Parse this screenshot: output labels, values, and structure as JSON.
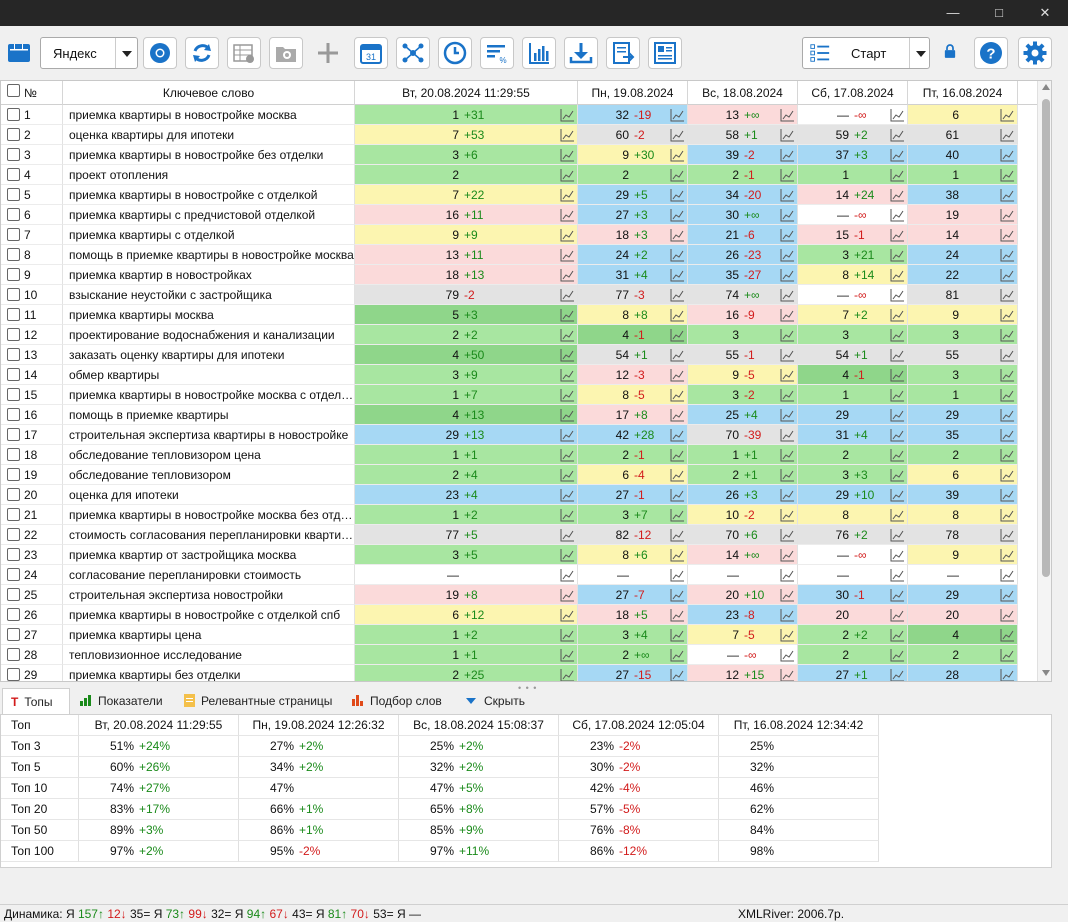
{
  "window_controls": [
    "—",
    "□",
    "✕"
  ],
  "toolbar": {
    "search_engine": "Яндекс",
    "start_label": "Старт",
    "calendar_day": "31"
  },
  "grid": {
    "columns": {
      "num": "№",
      "keyword": "Ключевое слово",
      "dates": [
        "Вт, 20.08.2024 11:29:55",
        "Пн, 19.08.2024",
        "Вс, 18.08.2024",
        "Сб, 17.08.2024",
        "Пт, 16.08.2024"
      ]
    },
    "rows": [
      {
        "n": "1",
        "kw": "приемка квартиры в новостройке москва",
        "c": [
          [
            "1",
            "+31",
            "green"
          ],
          [
            "32",
            "-19",
            "blue"
          ],
          [
            "13",
            "+∞",
            "pink"
          ],
          [
            "—",
            "-∞",
            "white"
          ],
          [
            "6",
            "",
            "yellow"
          ]
        ]
      },
      {
        "n": "2",
        "kw": "оценка квартиры для ипотеки",
        "c": [
          [
            "7",
            "+53",
            "yellow"
          ],
          [
            "60",
            "-2",
            "gray"
          ],
          [
            "58",
            "+1",
            "gray"
          ],
          [
            "59",
            "+2",
            "gray"
          ],
          [
            "61",
            "",
            "gray"
          ]
        ]
      },
      {
        "n": "3",
        "kw": "приемка квартиры в новостройке без отделки",
        "c": [
          [
            "3",
            "+6",
            "green"
          ],
          [
            "9",
            "+30",
            "yellow"
          ],
          [
            "39",
            "-2",
            "blue"
          ],
          [
            "37",
            "+3",
            "blue"
          ],
          [
            "40",
            "",
            "blue"
          ]
        ]
      },
      {
        "n": "4",
        "kw": "проект отопления",
        "c": [
          [
            "2",
            "",
            "green"
          ],
          [
            "2",
            "",
            "green"
          ],
          [
            "2",
            "-1",
            "green"
          ],
          [
            "1",
            "",
            "green"
          ],
          [
            "1",
            "",
            "green"
          ]
        ]
      },
      {
        "n": "5",
        "kw": "приемка квартиры в новостройке с отделкой",
        "c": [
          [
            "7",
            "+22",
            "yellow"
          ],
          [
            "29",
            "+5",
            "blue"
          ],
          [
            "34",
            "-20",
            "blue"
          ],
          [
            "14",
            "+24",
            "pink"
          ],
          [
            "38",
            "",
            "blue"
          ]
        ]
      },
      {
        "n": "6",
        "kw": "приемка квартиры с предчистовой отделкой",
        "c": [
          [
            "16",
            "+11",
            "pink"
          ],
          [
            "27",
            "+3",
            "blue"
          ],
          [
            "30",
            "+∞",
            "blue"
          ],
          [
            "—",
            "-∞",
            "white"
          ],
          [
            "19",
            "",
            "pink"
          ]
        ]
      },
      {
        "n": "7",
        "kw": "приемка квартиры с отделкой",
        "c": [
          [
            "9",
            "+9",
            "yellow"
          ],
          [
            "18",
            "+3",
            "pink"
          ],
          [
            "21",
            "-6",
            "blue"
          ],
          [
            "15",
            "-1",
            "pink"
          ],
          [
            "14",
            "",
            "pink"
          ]
        ]
      },
      {
        "n": "8",
        "kw": "помощь в приемке квартиры в новостройке москва",
        "c": [
          [
            "13",
            "+11",
            "pink"
          ],
          [
            "24",
            "+2",
            "blue"
          ],
          [
            "26",
            "-23",
            "blue"
          ],
          [
            "3",
            "+21",
            "green"
          ],
          [
            "24",
            "",
            "blue"
          ]
        ]
      },
      {
        "n": "9",
        "kw": "приемка квартир в новостройках",
        "c": [
          [
            "18",
            "+13",
            "pink"
          ],
          [
            "31",
            "+4",
            "blue"
          ],
          [
            "35",
            "-27",
            "blue"
          ],
          [
            "8",
            "+14",
            "yellow"
          ],
          [
            "22",
            "",
            "blue"
          ]
        ]
      },
      {
        "n": "10",
        "kw": "взыскание неустойки с застройщика",
        "c": [
          [
            "79",
            "-2",
            "gray"
          ],
          [
            "77",
            "-3",
            "gray"
          ],
          [
            "74",
            "+∞",
            "gray"
          ],
          [
            "—",
            "-∞",
            "white"
          ],
          [
            "81",
            "",
            "gray"
          ]
        ]
      },
      {
        "n": "11",
        "kw": "приемка квартиры москва",
        "c": [
          [
            "5",
            "+3",
            "dgreen"
          ],
          [
            "8",
            "+8",
            "yellow"
          ],
          [
            "16",
            "-9",
            "pink"
          ],
          [
            "7",
            "+2",
            "yellow"
          ],
          [
            "9",
            "",
            "yellow"
          ]
        ]
      },
      {
        "n": "12",
        "kw": "проектирование водоснабжения и канализации",
        "c": [
          [
            "2",
            "+2",
            "green"
          ],
          [
            "4",
            "-1",
            "dgreen"
          ],
          [
            "3",
            "",
            "green"
          ],
          [
            "3",
            "",
            "green"
          ],
          [
            "3",
            "",
            "green"
          ]
        ]
      },
      {
        "n": "13",
        "kw": "заказать оценку квартиры для ипотеки",
        "c": [
          [
            "4",
            "+50",
            "dgreen"
          ],
          [
            "54",
            "+1",
            "gray"
          ],
          [
            "55",
            "-1",
            "gray"
          ],
          [
            "54",
            "+1",
            "gray"
          ],
          [
            "55",
            "",
            "gray"
          ]
        ]
      },
      {
        "n": "14",
        "kw": "обмер квартиры",
        "c": [
          [
            "3",
            "+9",
            "green"
          ],
          [
            "12",
            "-3",
            "pink"
          ],
          [
            "9",
            "-5",
            "yellow"
          ],
          [
            "4",
            "-1",
            "dgreen"
          ],
          [
            "3",
            "",
            "green"
          ]
        ]
      },
      {
        "n": "15",
        "kw": "приемка квартиры в новостройке москва с отделкой",
        "c": [
          [
            "1",
            "+7",
            "green"
          ],
          [
            "8",
            "-5",
            "yellow"
          ],
          [
            "3",
            "-2",
            "green"
          ],
          [
            "1",
            "",
            "green"
          ],
          [
            "1",
            "",
            "green"
          ]
        ]
      },
      {
        "n": "16",
        "kw": "помощь в приемке квартиры",
        "c": [
          [
            "4",
            "+13",
            "dgreen"
          ],
          [
            "17",
            "+8",
            "pink"
          ],
          [
            "25",
            "+4",
            "blue"
          ],
          [
            "29",
            "",
            "blue"
          ],
          [
            "29",
            "",
            "blue"
          ]
        ]
      },
      {
        "n": "17",
        "kw": "строительная экспертиза квартиры в новостройке",
        "c": [
          [
            "29",
            "+13",
            "blue"
          ],
          [
            "42",
            "+28",
            "blue"
          ],
          [
            "70",
            "-39",
            "gray"
          ],
          [
            "31",
            "+4",
            "blue"
          ],
          [
            "35",
            "",
            "blue"
          ]
        ]
      },
      {
        "n": "18",
        "kw": "обследование тепловизором цена",
        "c": [
          [
            "1",
            "+1",
            "green"
          ],
          [
            "2",
            "-1",
            "green"
          ],
          [
            "1",
            "+1",
            "green"
          ],
          [
            "2",
            "",
            "green"
          ],
          [
            "2",
            "",
            "green"
          ]
        ]
      },
      {
        "n": "19",
        "kw": "обследование тепловизором",
        "c": [
          [
            "2",
            "+4",
            "green"
          ],
          [
            "6",
            "-4",
            "yellow"
          ],
          [
            "2",
            "+1",
            "green"
          ],
          [
            "3",
            "+3",
            "green"
          ],
          [
            "6",
            "",
            "yellow"
          ]
        ]
      },
      {
        "n": "20",
        "kw": "оценка для ипотеки",
        "c": [
          [
            "23",
            "+4",
            "blue"
          ],
          [
            "27",
            "-1",
            "blue"
          ],
          [
            "26",
            "+3",
            "blue"
          ],
          [
            "29",
            "+10",
            "blue"
          ],
          [
            "39",
            "",
            "blue"
          ]
        ]
      },
      {
        "n": "21",
        "kw": "приемка квартиры в новостройке москва без отделки",
        "c": [
          [
            "1",
            "+2",
            "green"
          ],
          [
            "3",
            "+7",
            "green"
          ],
          [
            "10",
            "-2",
            "yellow"
          ],
          [
            "8",
            "",
            "yellow"
          ],
          [
            "8",
            "",
            "yellow"
          ]
        ]
      },
      {
        "n": "22",
        "kw": "стоимость согласования перепланировки квартиры",
        "c": [
          [
            "77",
            "+5",
            "gray"
          ],
          [
            "82",
            "-12",
            "gray"
          ],
          [
            "70",
            "+6",
            "gray"
          ],
          [
            "76",
            "+2",
            "gray"
          ],
          [
            "78",
            "",
            "gray"
          ]
        ]
      },
      {
        "n": "23",
        "kw": "приемка квартир от застройщика москва",
        "c": [
          [
            "3",
            "+5",
            "green"
          ],
          [
            "8",
            "+6",
            "yellow"
          ],
          [
            "14",
            "+∞",
            "pink"
          ],
          [
            "—",
            "-∞",
            "white"
          ],
          [
            "9",
            "",
            "yellow"
          ]
        ]
      },
      {
        "n": "24",
        "kw": "согласование перепланировки стоимость",
        "c": [
          [
            "—",
            "",
            "white"
          ],
          [
            "—",
            "",
            "white"
          ],
          [
            "—",
            "",
            "white"
          ],
          [
            "—",
            "",
            "white"
          ],
          [
            "—",
            "",
            "white"
          ]
        ]
      },
      {
        "n": "25",
        "kw": "строительная экспертиза новостройки",
        "c": [
          [
            "19",
            "+8",
            "pink"
          ],
          [
            "27",
            "-7",
            "blue"
          ],
          [
            "20",
            "+10",
            "pink"
          ],
          [
            "30",
            "-1",
            "blue"
          ],
          [
            "29",
            "",
            "blue"
          ]
        ]
      },
      {
        "n": "26",
        "kw": "приемка квартиры в новостройке с отделкой спб",
        "c": [
          [
            "6",
            "+12",
            "yellow"
          ],
          [
            "18",
            "+5",
            "pink"
          ],
          [
            "23",
            "-8",
            "blue"
          ],
          [
            "20",
            "",
            "pink"
          ],
          [
            "20",
            "",
            "pink"
          ]
        ]
      },
      {
        "n": "27",
        "kw": "приемка квартиры цена",
        "c": [
          [
            "1",
            "+2",
            "green"
          ],
          [
            "3",
            "+4",
            "green"
          ],
          [
            "7",
            "-5",
            "yellow"
          ],
          [
            "2",
            "+2",
            "green"
          ],
          [
            "4",
            "",
            "dgreen"
          ]
        ]
      },
      {
        "n": "28",
        "kw": "тепловизионное исследование",
        "c": [
          [
            "1",
            "+1",
            "green"
          ],
          [
            "2",
            "+∞",
            "green"
          ],
          [
            "—",
            "-∞",
            "white"
          ],
          [
            "2",
            "",
            "green"
          ],
          [
            "2",
            "",
            "green"
          ]
        ]
      },
      {
        "n": "29",
        "kw": "приемка квартиры без отделки",
        "c": [
          [
            "2",
            "+25",
            "green"
          ],
          [
            "27",
            "-15",
            "blue"
          ],
          [
            "12",
            "+15",
            "pink"
          ],
          [
            "27",
            "+1",
            "blue"
          ],
          [
            "28",
            "",
            "blue"
          ]
        ]
      }
    ]
  },
  "tabs": [
    "Топы",
    "Показатели",
    "Релевантные страницы",
    "Подбор слов",
    "Скрыть"
  ],
  "tops": {
    "headers": [
      "Топ",
      "Вт, 20.08.2024 11:29:55",
      "Пн, 19.08.2024 12:26:32",
      "Вс, 18.08.2024 15:08:37",
      "Сб, 17.08.2024 12:05:04",
      "Пт, 16.08.2024 12:34:42"
    ],
    "rows": [
      {
        "label": "Топ 3",
        "v": [
          [
            "51%",
            "+24%"
          ],
          [
            "27%",
            "+2%"
          ],
          [
            "25%",
            "+2%"
          ],
          [
            "23%",
            "-2%"
          ],
          [
            "25%",
            ""
          ]
        ]
      },
      {
        "label": "Топ 5",
        "v": [
          [
            "60%",
            "+26%"
          ],
          [
            "34%",
            "+2%"
          ],
          [
            "32%",
            "+2%"
          ],
          [
            "30%",
            "-2%"
          ],
          [
            "32%",
            ""
          ]
        ]
      },
      {
        "label": "Топ 10",
        "v": [
          [
            "74%",
            "+27%"
          ],
          [
            "47%",
            ""
          ],
          [
            "47%",
            "+5%"
          ],
          [
            "42%",
            "-4%"
          ],
          [
            "46%",
            ""
          ]
        ]
      },
      {
        "label": "Топ 20",
        "v": [
          [
            "83%",
            "+17%"
          ],
          [
            "66%",
            "+1%"
          ],
          [
            "65%",
            "+8%"
          ],
          [
            "57%",
            "-5%"
          ],
          [
            "62%",
            ""
          ]
        ]
      },
      {
        "label": "Топ 50",
        "v": [
          [
            "89%",
            "+3%"
          ],
          [
            "86%",
            "+1%"
          ],
          [
            "85%",
            "+9%"
          ],
          [
            "76%",
            "-8%"
          ],
          [
            "84%",
            ""
          ]
        ]
      },
      {
        "label": "Топ 100",
        "v": [
          [
            "97%",
            "+2%"
          ],
          [
            "95%",
            "-2%"
          ],
          [
            "97%",
            "+11%"
          ],
          [
            "86%",
            "-12%"
          ],
          [
            "98%",
            ""
          ]
        ]
      }
    ]
  },
  "status": {
    "prefix": "Динамика:",
    "parts": [
      {
        "t": "Я ",
        "c": "n"
      },
      {
        "t": "157↑",
        "c": "up"
      },
      {
        "t": " 12↓",
        "c": "dn"
      },
      {
        "t": " 35= ",
        "c": "n"
      },
      {
        "t": "Я ",
        "c": "n"
      },
      {
        "t": "73↑",
        "c": "up"
      },
      {
        "t": " 99↓",
        "c": "dn"
      },
      {
        "t": " 32= ",
        "c": "n"
      },
      {
        "t": "Я ",
        "c": "n"
      },
      {
        "t": "94↑",
        "c": "up"
      },
      {
        "t": " 67↓",
        "c": "dn"
      },
      {
        "t": " 43= ",
        "c": "n"
      },
      {
        "t": "Я ",
        "c": "n"
      },
      {
        "t": "81↑",
        "c": "up"
      },
      {
        "t": " 70↓",
        "c": "dn"
      },
      {
        "t": " 53= ",
        "c": "n"
      },
      {
        "t": "Я —",
        "c": "n"
      }
    ],
    "balance": "XMLRiver: 2006.7р."
  },
  "colors": {
    "up": "#1a8a1a",
    "down": "#d21b1b",
    "accent": "#1a73c8"
  }
}
